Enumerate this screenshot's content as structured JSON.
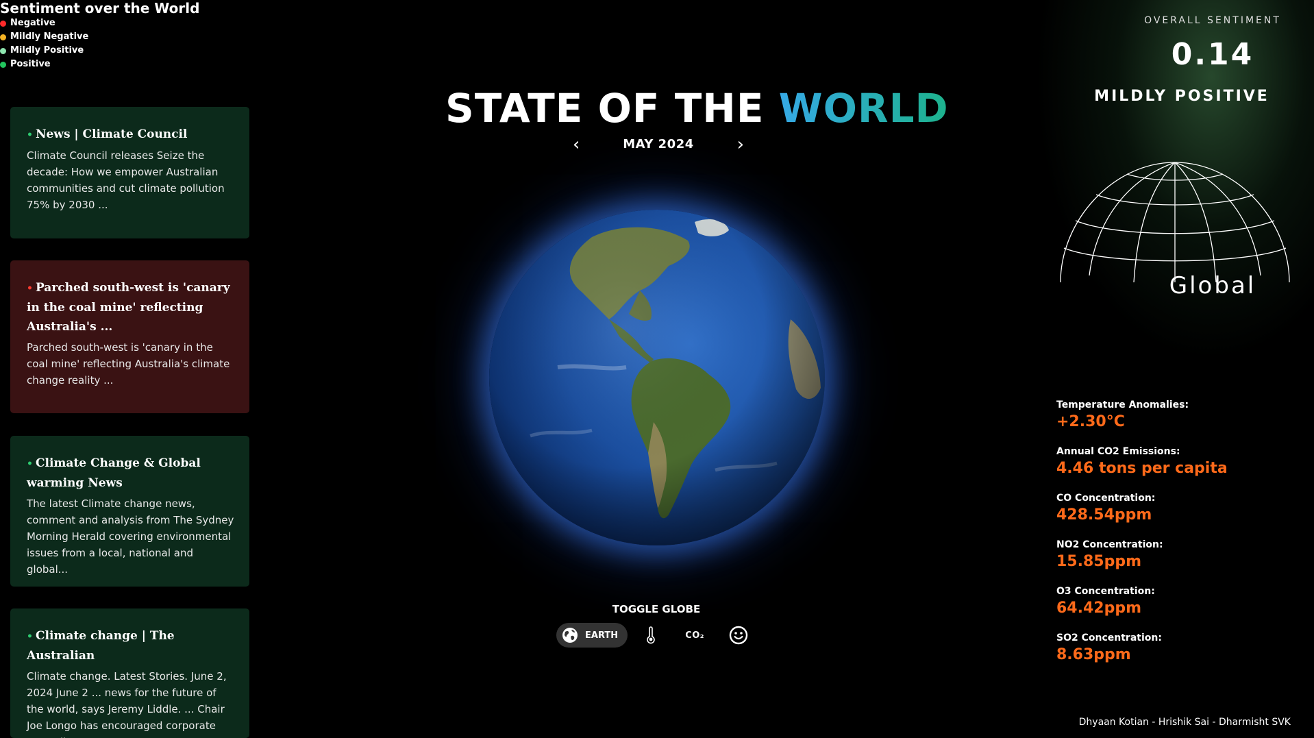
{
  "legend": {
    "title": "Sentiment over the World",
    "items": [
      {
        "label": "Negative",
        "color": "#ff2a2a"
      },
      {
        "label": "Mildly Negative",
        "color": "#f5b324"
      },
      {
        "label": "Mildly Positive",
        "color": "#8ee6b0"
      },
      {
        "label": "Positive",
        "color": "#22c55e"
      }
    ]
  },
  "news": [
    {
      "title": "News | Climate Council",
      "sentiment": "positive",
      "body": "Climate Council releases Seize the decade: How we empower Australian communities and cut climate pollution 75% by 2030 ..."
    },
    {
      "title": "Parched south-west is 'canary in the coal mine' reflecting Australia's ...",
      "sentiment": "negative",
      "body": "Parched south-west is 'canary in the coal mine' reflecting Australia's climate change reality ..."
    },
    {
      "title": "Climate Change & Global warming News",
      "sentiment": "positive",
      "body": "The latest Climate change news, comment and analysis from The Sydney Morning Herald covering environmental issues from a local, national and global..."
    },
    {
      "title": "Climate change | The Australian",
      "sentiment": "positive",
      "body": "Climate change. Latest Stories. June 2, 2024 June 2 ... news for the future of the world, says Jeremy Liddle. ... Chair Joe Longo has encouraged corporate Australia..."
    }
  ],
  "header": {
    "title_main": "STATE OF THE ",
    "title_accent": "WORLD",
    "date": "MAY 2024",
    "prev_arrow": "‹",
    "next_arrow": "›"
  },
  "toggle": {
    "label": "TOGGLE GLOBE",
    "active": "EARTH",
    "icons": [
      "earth-icon",
      "thermometer-icon",
      "co2-icon",
      "smiley-icon"
    ],
    "co2_text": "CO₂"
  },
  "sentiment": {
    "label": "OVERALL SENTIMENT",
    "value": "0.14",
    "classification": "MILDLY POSITIVE",
    "region": "Global"
  },
  "stats": [
    {
      "label": "Temperature Anomalies:",
      "value": "+2.30°C"
    },
    {
      "label": "Annual CO2 Emissions:",
      "value": "4.46 tons per capita"
    },
    {
      "label": "CO Concentration:",
      "value": "428.54ppm"
    },
    {
      "label": "NO2 Concentration:",
      "value": "15.85ppm"
    },
    {
      "label": "O3 Concentration:",
      "value": "64.42ppm"
    },
    {
      "label": "SO2 Concentration:",
      "value": "8.63ppm"
    }
  ],
  "credits": "Dhyaan Kotian - Hrishik Sai - Dharmisht SVK",
  "colors": {
    "accent_value": "#ff6a1a",
    "positive_card": "#0c2a1b",
    "negative_card": "#3a1213"
  }
}
